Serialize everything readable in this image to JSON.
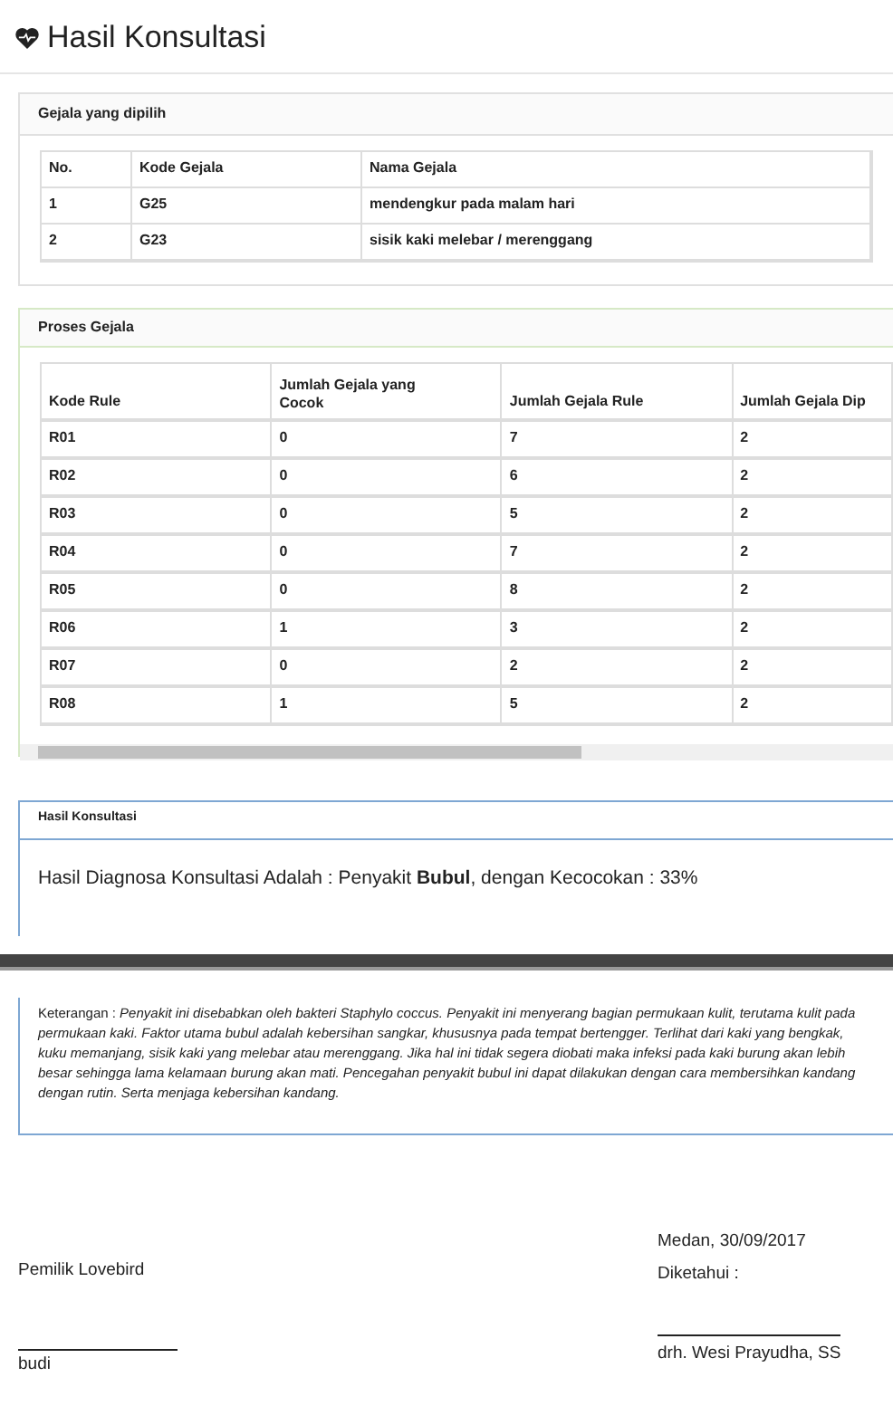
{
  "page_title": "Hasil Konsultasi",
  "selected_symptoms": {
    "title": "Gejala yang dipilih",
    "columns": [
      "No.",
      "Kode Gejala",
      "Nama Gejala"
    ],
    "rows": [
      [
        "1",
        "G25",
        "mendengkur pada malam hari"
      ],
      [
        "2",
        "G23",
        "sisik kaki melebar / merenggang"
      ]
    ]
  },
  "process": {
    "title": "Proses Gejala",
    "columns": [
      "Kode Rule",
      "Jumlah Gejala yang Cocok",
      "Jumlah Gejala Rule",
      "Jumlah Gejala Dip"
    ],
    "rows": [
      [
        "R01",
        "0",
        "7",
        "2"
      ],
      [
        "R02",
        "0",
        "6",
        "2"
      ],
      [
        "R03",
        "0",
        "5",
        "2"
      ],
      [
        "R04",
        "0",
        "7",
        "2"
      ],
      [
        "R05",
        "0",
        "8",
        "2"
      ],
      [
        "R06",
        "1",
        "3",
        "2"
      ],
      [
        "R07",
        "0",
        "2",
        "2"
      ],
      [
        "R08",
        "1",
        "5",
        "2"
      ]
    ]
  },
  "result": {
    "title": "Hasil Konsultasi",
    "text": "Hasil Diagnosa Konsultasi Adalah : Penyakit **Bubul**, dengan Kecocokan : 33%"
  },
  "note": "Keterangan : *Penyakit ini disebabkan oleh bakteri Staphylo coccus. Penyakit ini menyerang bagian permukaan kulit, terutama kulit pada permukaan kaki. Faktor utama bubul adalah kebersihan sangkar, khususnya pada tempat bertengger. Terlihat dari kaki yang bengkak, kuku memanjang, sisik kaki yang melebar atau merenggang. Jika hal ini tidak segera diobati maka infeksi pada kaki burung akan lebih besar sehingga lama kelamaan burung akan mati. Pencegahan penyakit bubul ini dapat dilakukan dengan cara membersihkan kandang dengan rutin. Serta menjaga kebersihan kandang.*",
  "signatures": {
    "left": {
      "role": "Pemilik Lovebird",
      "name": "budi"
    },
    "right": {
      "place_date": "Medan, 30/09/2017",
      "role": "Diketahui :",
      "name": "drh. Wesi Prayudha, SS"
    }
  }
}
